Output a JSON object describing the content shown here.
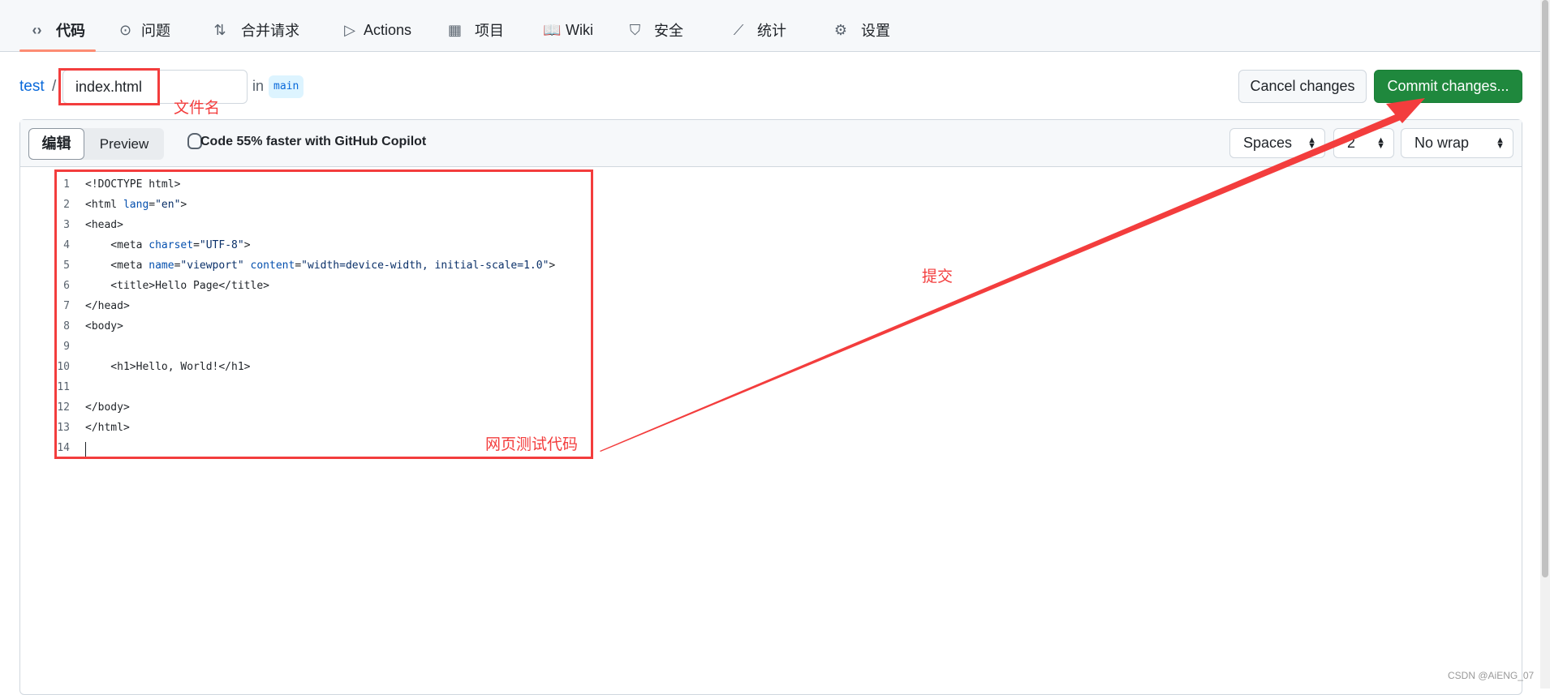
{
  "nav": {
    "items": [
      {
        "label": "代码",
        "icon": "code-icon",
        "active": true
      },
      {
        "label": "问题",
        "icon": "issue-icon"
      },
      {
        "label": "合并请求",
        "icon": "pull-request-icon"
      },
      {
        "label": "Actions",
        "icon": "play-icon"
      },
      {
        "label": "项目",
        "icon": "table-icon"
      },
      {
        "label": "Wiki",
        "icon": "book-icon"
      },
      {
        "label": "安全",
        "icon": "shield-icon"
      },
      {
        "label": "统计",
        "icon": "graph-icon"
      },
      {
        "label": "设置",
        "icon": "gear-icon"
      }
    ]
  },
  "path": {
    "repo": "test",
    "separator": "/",
    "filename": "index.html",
    "in": "in",
    "branch": "main"
  },
  "actions": {
    "cancel": "Cancel changes",
    "commit": "Commit changes..."
  },
  "editor": {
    "tabs": [
      "编辑",
      "Preview"
    ],
    "copilot": "Code 55% faster with GitHub Copilot",
    "indent_mode": "Spaces",
    "indent_size": "2",
    "wrap_mode": "No wrap",
    "lines": [
      [
        [
          "t",
          "<!DOCTYPE html>"
        ]
      ],
      [
        [
          "t",
          "<html "
        ],
        [
          "a",
          "lang"
        ],
        [
          "t",
          "="
        ],
        [
          "s",
          "\"en\""
        ],
        [
          "t",
          ">"
        ]
      ],
      [
        [
          "t",
          "<head>"
        ]
      ],
      [
        [
          "t",
          "    <meta "
        ],
        [
          "a",
          "charset"
        ],
        [
          "t",
          "="
        ],
        [
          "s",
          "\"UTF-8\""
        ],
        [
          "t",
          ">"
        ]
      ],
      [
        [
          "t",
          "    <meta "
        ],
        [
          "a",
          "name"
        ],
        [
          "t",
          "="
        ],
        [
          "s",
          "\"viewport\""
        ],
        [
          "t",
          " "
        ],
        [
          "a",
          "content"
        ],
        [
          "t",
          "="
        ],
        [
          "s",
          "\"width=device-width, initial-scale=1.0\""
        ],
        [
          "t",
          ">"
        ]
      ],
      [
        [
          "t",
          "    <title>Hello Page</title>"
        ]
      ],
      [
        [
          "t",
          "</head>"
        ]
      ],
      [
        [
          "t",
          "<body>"
        ]
      ],
      [],
      [
        [
          "t",
          "    <h1>Hello, World!</h1>"
        ]
      ],
      [],
      [
        [
          "t",
          "</body>"
        ]
      ],
      [
        [
          "t",
          "</html>"
        ]
      ],
      []
    ]
  },
  "annotations": {
    "filename": "文件名",
    "code": "网页测试代码",
    "commit": "提交",
    "color": "#f33d3d"
  },
  "watermark": "CSDN @AiENG_07",
  "colors": {
    "accent": "#0969da",
    "commit": "#1f883d",
    "underline": "#fd8c73"
  }
}
